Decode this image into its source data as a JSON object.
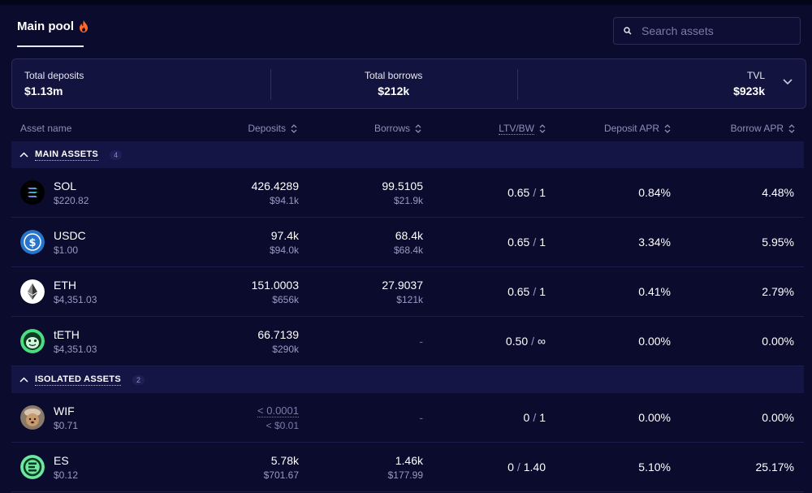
{
  "header": {
    "tab_label": "Main pool",
    "search_placeholder": "Search assets"
  },
  "summary": {
    "deposits_label": "Total deposits",
    "deposits_value": "$1.13m",
    "borrows_label": "Total borrows",
    "borrows_value": "$212k",
    "tvl_label": "TVL",
    "tvl_value": "$923k"
  },
  "columns": {
    "asset": "Asset name",
    "deposits": "Deposits",
    "borrows": "Borrows",
    "ltv": "LTV/BW",
    "deposit_apr": "Deposit APR",
    "borrow_apr": "Borrow APR"
  },
  "groups": {
    "main": {
      "title": "MAIN ASSETS",
      "count": "4"
    },
    "isolated": {
      "title": "ISOLATED ASSETS",
      "count": "2"
    }
  },
  "rows": [
    {
      "symbol": "SOL",
      "price": "$220.82",
      "deposits": "426.4289",
      "deposits_usd": "$94.1k",
      "borrows": "99.5105",
      "borrows_usd": "$21.9k",
      "ltv": "0.65",
      "bw": "1",
      "deposit_apr": "0.84%",
      "borrow_apr": "4.48%",
      "icon": "sol-icon"
    },
    {
      "symbol": "USDC",
      "price": "$1.00",
      "deposits": "97.4k",
      "deposits_usd": "$94.0k",
      "borrows": "68.4k",
      "borrows_usd": "$68.4k",
      "ltv": "0.65",
      "bw": "1",
      "deposit_apr": "3.34%",
      "borrow_apr": "5.95%",
      "icon": "usdc-icon"
    },
    {
      "symbol": "ETH",
      "price": "$4,351.03",
      "deposits": "151.0003",
      "deposits_usd": "$656k",
      "borrows": "27.9037",
      "borrows_usd": "$121k",
      "ltv": "0.65",
      "bw": "1",
      "deposit_apr": "0.41%",
      "borrow_apr": "2.79%",
      "icon": "eth-icon"
    },
    {
      "symbol": "tETH",
      "price": "$4,351.03",
      "deposits": "66.7139",
      "deposits_usd": "$290k",
      "borrows": "-",
      "borrows_usd": "",
      "ltv": "0.50",
      "bw": "∞",
      "deposit_apr": "0.00%",
      "borrow_apr": "0.00%",
      "icon": "teth-icon"
    },
    {
      "symbol": "WIF",
      "price": "$0.71",
      "deposits": "< 0.0001",
      "deposits_usd": "< $0.01",
      "borrows": "-",
      "borrows_usd": "",
      "ltv": "0",
      "bw": "1",
      "deposit_apr": "0.00%",
      "borrow_apr": "0.00%",
      "icon": "wif-icon"
    },
    {
      "symbol": "ES",
      "price": "$0.12",
      "deposits": "5.78k",
      "deposits_usd": "$701.67",
      "borrows": "1.46k",
      "borrows_usd": "$177.99",
      "ltv": "0",
      "bw": "1.40",
      "deposit_apr": "5.10%",
      "borrow_apr": "25.17%",
      "icon": "es-icon"
    }
  ],
  "colors": {
    "background": "#0b0b2e",
    "panel": "#13133f",
    "group_bar": "#151545",
    "muted_text": "#9a9ac4",
    "fire": "#ff6a2b"
  }
}
